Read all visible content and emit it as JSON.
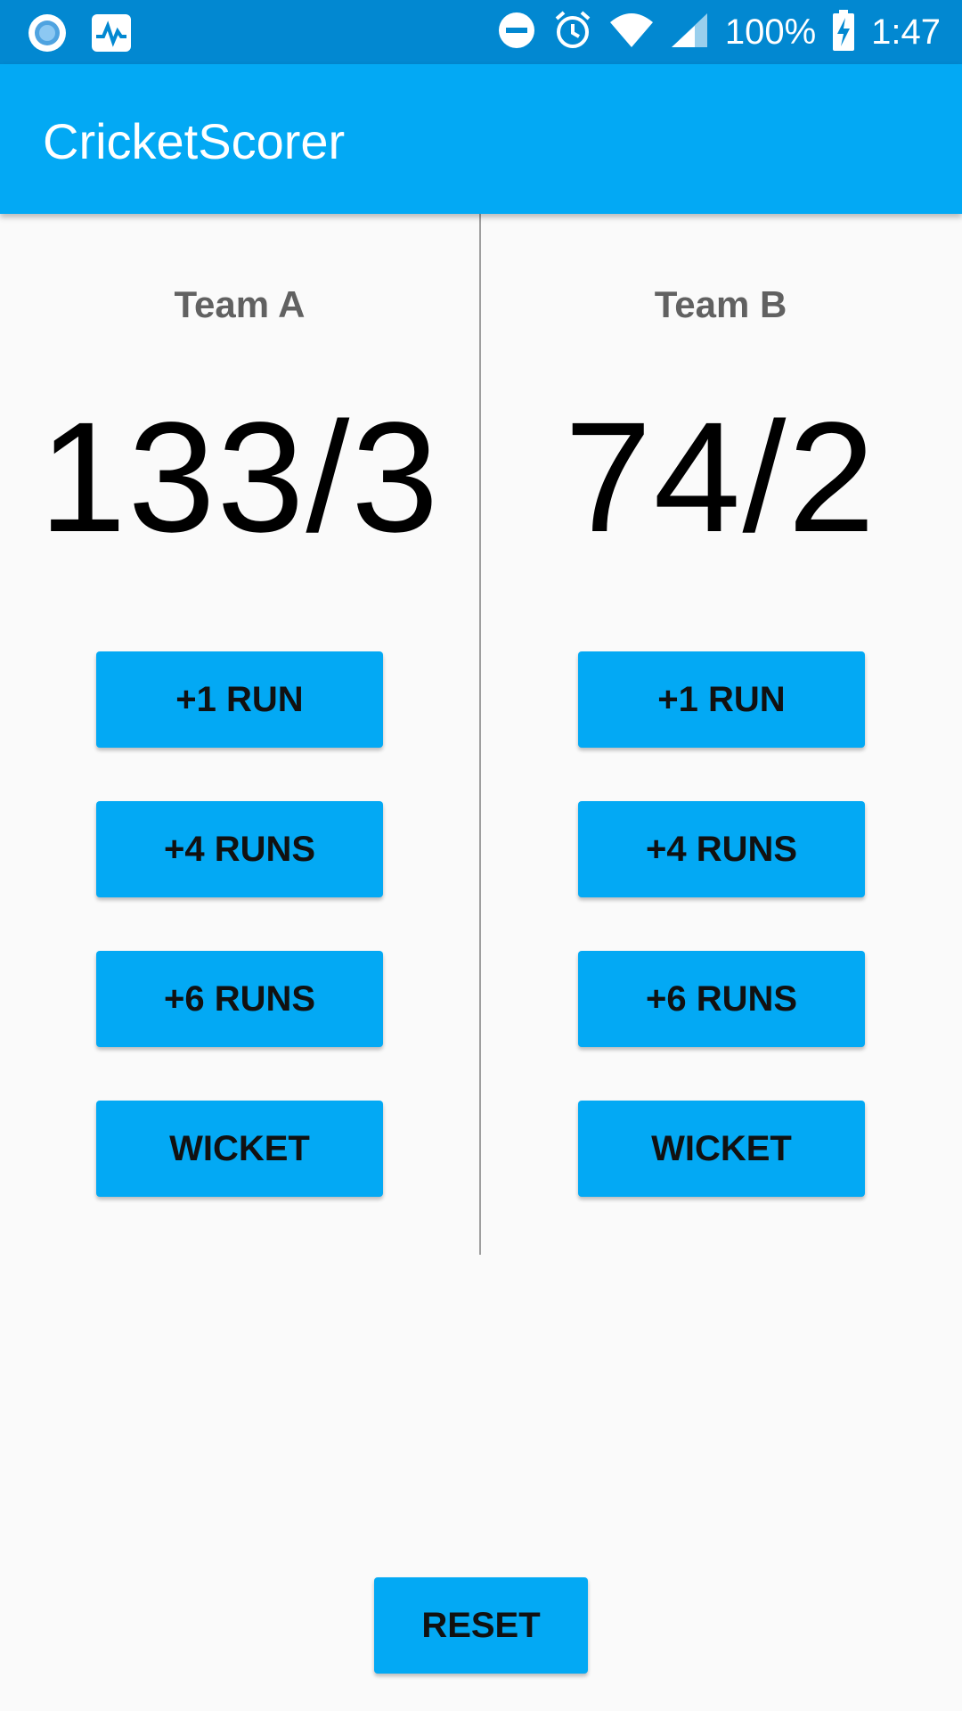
{
  "status_bar": {
    "battery": "100%",
    "time": "1:47",
    "icons": [
      "app-circle-icon",
      "pulse-icon",
      "do-not-disturb-icon",
      "alarm-icon",
      "wifi-icon",
      "signal-icon",
      "battery-charging-icon"
    ]
  },
  "app_bar": {
    "title": "CricketScorer"
  },
  "team_a": {
    "name": "Team A",
    "score": "133/3",
    "buttons": {
      "one_run": "+1 RUN",
      "four_runs": "+4 RUNS",
      "six_runs": "+6 RUNS",
      "wicket": "WICKET"
    }
  },
  "team_b": {
    "name": "Team B",
    "score": "74/2",
    "buttons": {
      "one_run": "+1 RUN",
      "four_runs": "+4 RUNS",
      "six_runs": "+6 RUNS",
      "wicket": "WICKET"
    }
  },
  "reset_label": "RESET",
  "colors": {
    "status_bar": "#0288d1",
    "app_bar": "#03a9f4",
    "button": "#03a9f4",
    "background": "#fafafa",
    "team_label": "#616161"
  }
}
